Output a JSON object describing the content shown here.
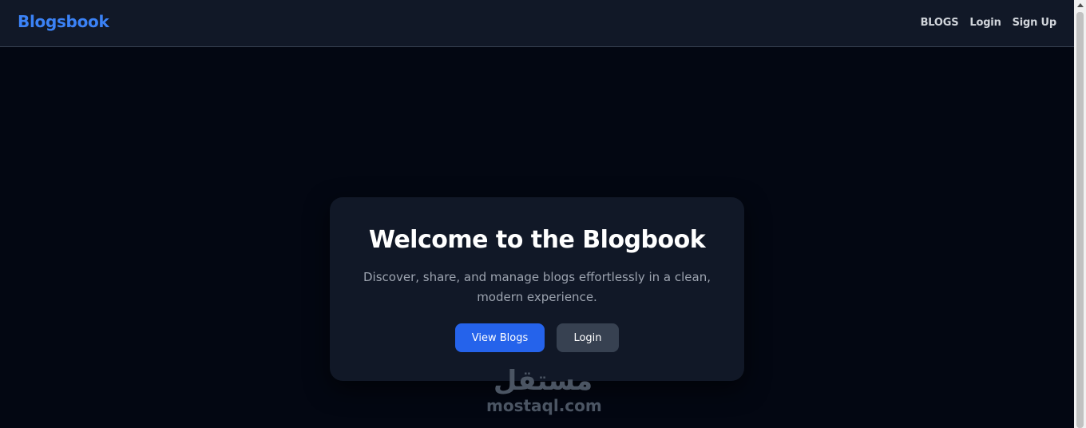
{
  "navbar": {
    "brand": "Blogsbook",
    "links": [
      {
        "label": "BLOGS"
      },
      {
        "label": "Login"
      },
      {
        "label": "Sign Up"
      }
    ]
  },
  "hero": {
    "title": "Welcome to the Blogbook",
    "subtitle": "Discover, share, and manage blogs effortlessly in a clean, modern experience.",
    "primary_button": "View Blogs",
    "secondary_button": "Login"
  },
  "watermark": {
    "arabic": "مستقل",
    "latin": "mostaql.com"
  },
  "colors": {
    "background": "#030712",
    "navbar": "#111827",
    "brand": "#3b82f6",
    "primary_button": "#2563eb",
    "secondary_button": "#374151"
  }
}
